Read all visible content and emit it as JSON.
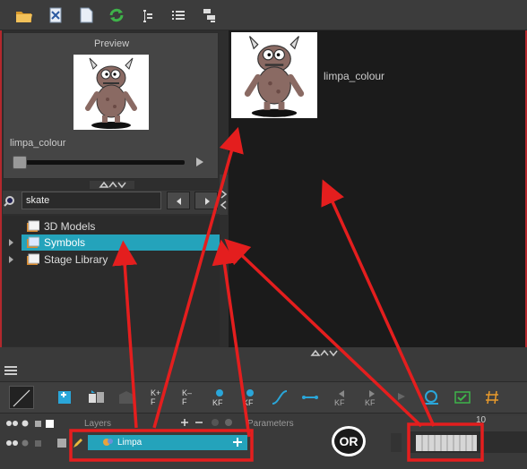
{
  "toolbar": {
    "icons": [
      "open-folder-icon",
      "excel-icon",
      "document-icon",
      "refresh-icon",
      "tree-view-icon",
      "list-view-icon",
      "expand-icon"
    ]
  },
  "preview": {
    "title": "Preview",
    "name": "limpa_colour"
  },
  "search": {
    "value": "skate"
  },
  "library_tree": {
    "items": [
      {
        "label": "3D Models"
      },
      {
        "label": "Symbols",
        "selected": true
      },
      {
        "label": "Stage Library"
      }
    ]
  },
  "gallery": {
    "items": [
      {
        "label": "limpa_colour"
      }
    ]
  },
  "timeline": {
    "layers_label": "Layers",
    "params_label": "Parameters",
    "layer": {
      "name": "Limpa"
    },
    "frame_number": "10"
  },
  "annotation": {
    "or_label": "OR"
  },
  "colors": {
    "accent": "#24a3bb",
    "highlight_red": "#e41e1e"
  }
}
